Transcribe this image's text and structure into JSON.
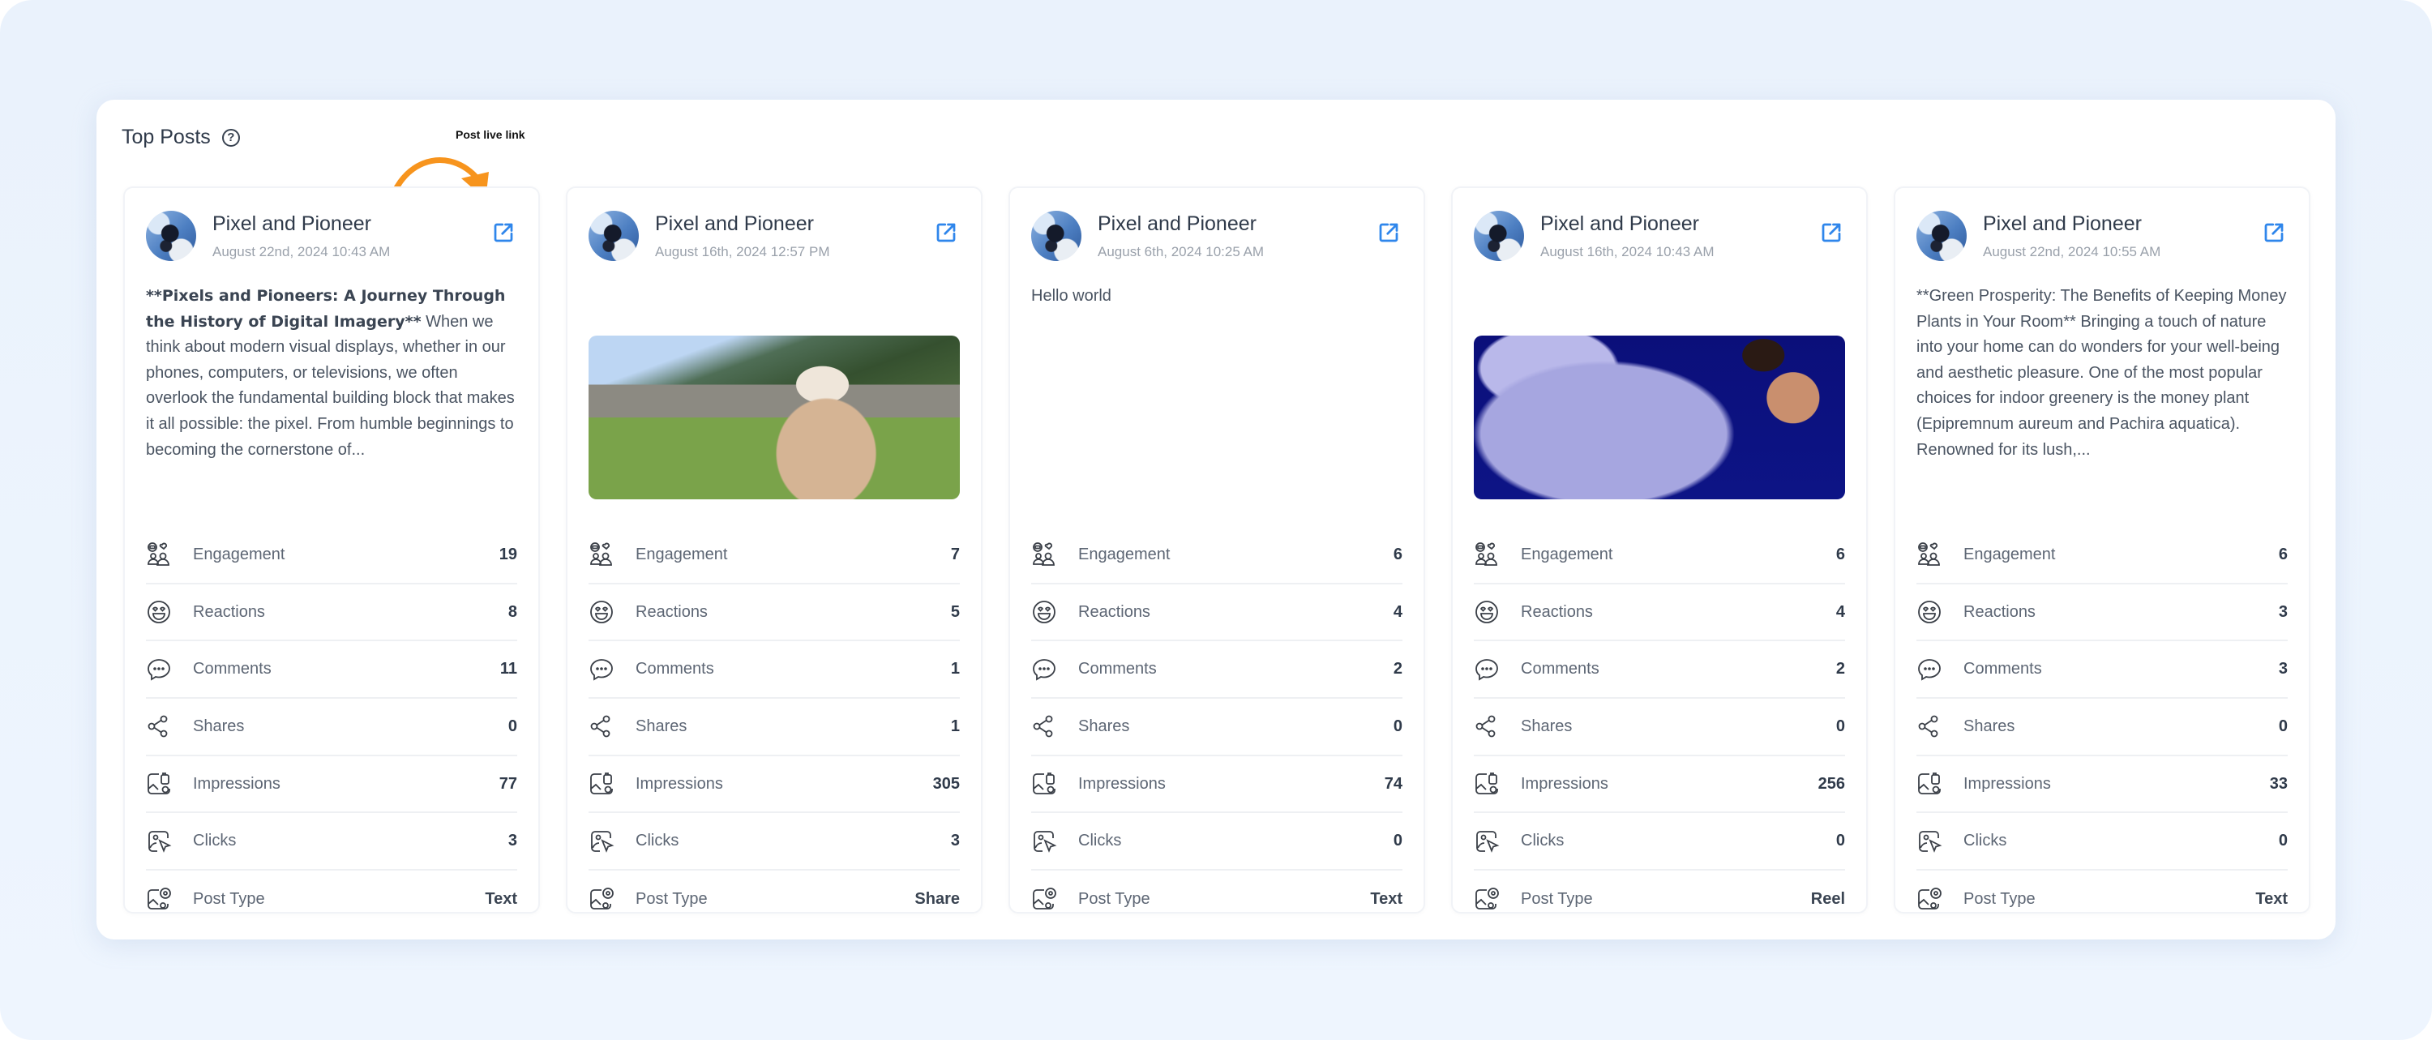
{
  "panel": {
    "title": "Top Posts",
    "help_icon": "question-circle-icon"
  },
  "annotation": {
    "label": "Post live link",
    "color": "#f7941d"
  },
  "colors": {
    "link_icon": "#2f86eb",
    "background": "#eef4fd"
  },
  "metric_labels": {
    "engagement": "Engagement",
    "reactions": "Reactions",
    "comments": "Comments",
    "shares": "Shares",
    "impressions": "Impressions",
    "clicks": "Clicks",
    "post_type": "Post Type"
  },
  "posts": [
    {
      "author": "Pixel and Pioneer",
      "date": "August 22nd, 2024 10:43 AM",
      "text_bold": "**Pixels and Pioneers: A Journey Through the History of Digital Imagery**",
      "text": " When we think about modern visual displays, whether in our phones, computers, or televisions, we often overlook the fundamental building block that makes it all possible: the pixel. From humble beginnings to becoming the cornerstone of...",
      "image": null,
      "metrics": {
        "engagement": "19",
        "reactions": "8",
        "comments": "11",
        "shares": "0",
        "impressions": "77",
        "clicks": "3",
        "post_type": "Text"
      }
    },
    {
      "author": "Pixel and Pioneer",
      "date": "August 16th, 2024 12:57 PM",
      "text_bold": "",
      "text": "",
      "image": "goat-in-meadow-photo",
      "metrics": {
        "engagement": "7",
        "reactions": "5",
        "comments": "1",
        "shares": "1",
        "impressions": "305",
        "clicks": "3",
        "post_type": "Share"
      }
    },
    {
      "author": "Pixel and Pioneer",
      "date": "August 6th, 2024 10:25 AM",
      "text_bold": "",
      "text": "Hello world",
      "image": null,
      "metrics": {
        "engagement": "6",
        "reactions": "4",
        "comments": "2",
        "shares": "0",
        "impressions": "74",
        "clicks": "0",
        "post_type": "Text"
      }
    },
    {
      "author": "Pixel and Pioneer",
      "date": "August 16th, 2024 10:43 AM",
      "text_bold": "",
      "text": "",
      "image": "figure-skater-photo",
      "metrics": {
        "engagement": "6",
        "reactions": "4",
        "comments": "2",
        "shares": "0",
        "impressions": "256",
        "clicks": "0",
        "post_type": "Reel"
      }
    },
    {
      "author": "Pixel and Pioneer",
      "date": "August 22nd, 2024 10:55 AM",
      "text_bold": "",
      "text": "**Green Prosperity: The Benefits of Keeping Money Plants in Your Room** Bringing a touch of nature into your home can do wonders for your well-being and aesthetic pleasure. One of the most popular choices for indoor greenery is the money plant (Epipremnum aureum and Pachira aquatica). Renowned for its lush,...",
      "image": null,
      "metrics": {
        "engagement": "6",
        "reactions": "3",
        "comments": "3",
        "shares": "0",
        "impressions": "33",
        "clicks": "0",
        "post_type": "Text"
      }
    }
  ]
}
